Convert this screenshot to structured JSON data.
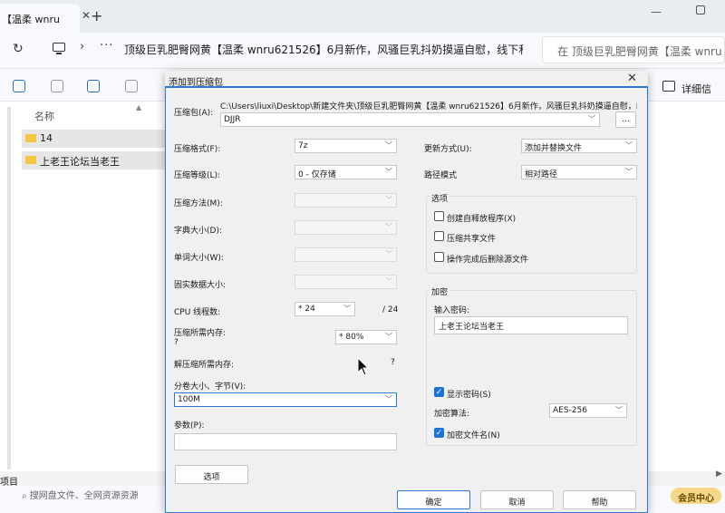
{
  "browser": {
    "tab_title": "【温柔 wnru",
    "tab_close": "✕",
    "new_tab": "+",
    "address": "顶级巨乳肥臀网黄【温柔 wnru621526】6月新作，风骚巨乳抖奶摸逼自慰，线下和",
    "search_placeholder": "在 顶级巨乳肥臀网黄【温柔 wnru",
    "details_label": "详细信"
  },
  "explorer": {
    "column_name": "名称",
    "files": [
      "14",
      "上老王论坛当老王"
    ],
    "status_text": "项目",
    "bottom_search": "搜网盘文件、全网资源资源",
    "vip_label": "会员中心"
  },
  "dialog": {
    "title": "添加到压缩包",
    "archive_label": "压缩包(A):",
    "archive_path": "C:\\Users\\liuxi\\Desktop\\新建文件夹\\顶级巨乳肥臀网黄【温柔 wnru621526】6月新作，风骚巨乳抖奶摸逼自慰，线下",
    "archive_name": "DJJR",
    "browse_label": "...",
    "left": {
      "format_label": "压缩格式(F):",
      "format_value": "7z",
      "level_label": "压缩等级(L):",
      "level_value": "0 - 仅存储",
      "method_label": "压缩方法(M):",
      "dict_label": "字典大小(D):",
      "word_label": "单词大小(W):",
      "solid_label": "固实数据大小:",
      "cpu_label": "CPU 线程数:",
      "cpu_value": "* 24",
      "cpu_max": "/ 24",
      "mem_label": "压缩所需内存:",
      "mem_q": "?",
      "mem_value": "* 80%",
      "demem_label": "解压缩所需内存:",
      "demem_value": "?",
      "split_label": "分卷大小、字节(V):",
      "split_value": "100M",
      "params_label": "参数(P):",
      "params_value": ""
    },
    "right": {
      "update_label": "更新方式(U):",
      "update_value": "添加并替换文件",
      "path_label": "路径模式",
      "path_value": "相对路径",
      "options_title": "选项",
      "opt_sfx": "创建自释放程序(X)",
      "opt_shared": "压缩共享文件",
      "opt_delete": "操作完成后删除源文件",
      "enc_title": "加密",
      "pwd_label": "输入密码:",
      "pwd_value": "上老王论坛当老王",
      "show_pwd": "显示密码(S)",
      "enc_method_label": "加密算法:",
      "enc_method_value": "AES-256",
      "enc_names": "加密文件名(N)"
    },
    "buttons": {
      "options": "选项",
      "ok": "确定",
      "cancel": "取消",
      "help": "帮助"
    }
  }
}
